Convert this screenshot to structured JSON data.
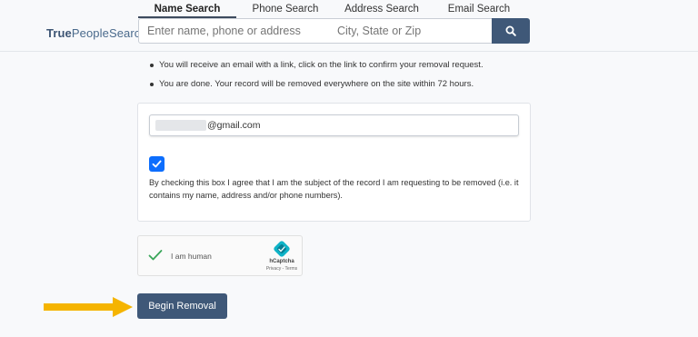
{
  "header": {
    "logo": {
      "bold": "True",
      "regular": "PeopleSearch"
    },
    "tabs": [
      {
        "label": "Name Search",
        "active": true
      },
      {
        "label": "Phone Search",
        "active": false
      },
      {
        "label": "Address Search",
        "active": false
      },
      {
        "label": "Email Search",
        "active": false
      }
    ],
    "search": {
      "query_placeholder": "Enter name, phone or address",
      "location_placeholder": "City, State or Zip",
      "button_icon": "search-icon"
    }
  },
  "instructions": [
    "You will receive an email with a link, click on the link to confirm your removal request.",
    "You are done. Your record will be removed everywhere on the site within 72 hours."
  ],
  "form": {
    "email_value": "@gmail.com",
    "checkbox_checked": true,
    "agreement_text": "By checking this box I agree that I am the subject of the record I am requesting to be removed (i.e. it contains my name, address and/or phone numbers)."
  },
  "captcha": {
    "label": "I am human",
    "brand": "hCaptcha",
    "links": "Privacy - Terms"
  },
  "action": {
    "submit_label": "Begin Removal"
  },
  "colors": {
    "primary": "#3f5878",
    "checkbox": "#0d6efd",
    "arrow": "#f5b400"
  }
}
